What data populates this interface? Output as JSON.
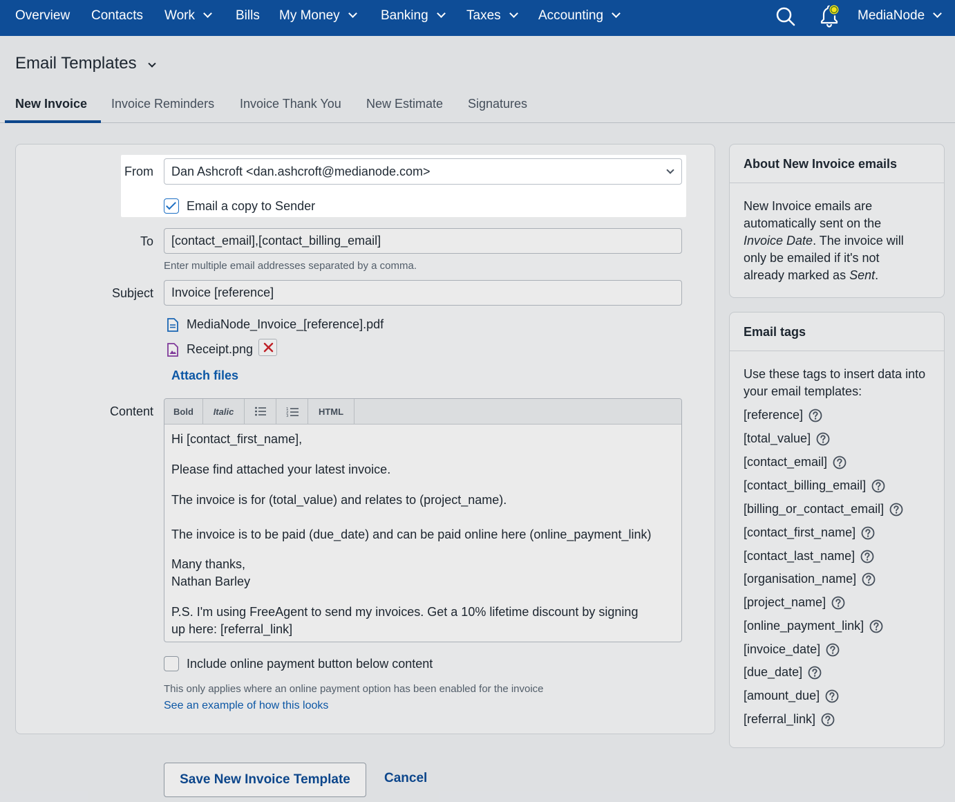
{
  "nav": {
    "items": [
      {
        "label": "Overview",
        "dropdown": false
      },
      {
        "label": "Contacts",
        "dropdown": false
      },
      {
        "label": "Work",
        "dropdown": true
      },
      {
        "label": "Bills",
        "dropdown": false
      },
      {
        "label": "My Money",
        "dropdown": true
      },
      {
        "label": "Banking",
        "dropdown": true
      },
      {
        "label": "Taxes",
        "dropdown": true
      },
      {
        "label": "Accounting",
        "dropdown": true
      }
    ],
    "account": "MediaNode",
    "icons": [
      "search-icon",
      "bell-icon"
    ],
    "brand_color": "#0e4d97"
  },
  "page": {
    "title": "Email Templates",
    "tabs": [
      {
        "label": "New Invoice",
        "active": true
      },
      {
        "label": "Invoice Reminders",
        "active": false
      },
      {
        "label": "Invoice Thank You",
        "active": false
      },
      {
        "label": "New Estimate",
        "active": false
      },
      {
        "label": "Signatures",
        "active": false
      }
    ]
  },
  "form": {
    "from_label": "From",
    "from_value": "Dan Ashcroft <dan.ashcroft@medianode.com>",
    "copy_sender_label": "Email a copy to Sender",
    "copy_sender_checked": true,
    "to_label": "To",
    "to_value": "[contact_email],[contact_billing_email]",
    "to_hint": "Enter multiple email addresses separated by a comma.",
    "subject_label": "Subject",
    "subject_value": "Invoice [reference]",
    "attachments": [
      {
        "name": "MediaNode_Invoice_[reference].pdf",
        "icon": "document-icon",
        "removable": false
      },
      {
        "name": "Receipt.png",
        "icon": "image-file-icon",
        "removable": true
      }
    ],
    "attach_files_label": "Attach files",
    "content_label": "Content",
    "toolbar": {
      "bold": "Bold",
      "italic": "Italic",
      "bullet_list_icon": "bullet-list-icon",
      "numbered_list_icon": "numbered-list-icon",
      "html": "HTML"
    },
    "content_lines": [
      "Hi [contact_first_name],",
      "Please find attached your latest invoice.",
      "The invoice is for (total_value) and relates to (project_name).",
      "The invoice is to be paid (due_date) and can be paid online here (online_payment_link)",
      "Many thanks,",
      "Nathan Barley",
      "P.S. I'm using FreeAgent to send my invoices. Get a 10% lifetime discount by signing",
      "up here: [referral_link]"
    ],
    "payment_button_label": "Include online payment button below content",
    "payment_button_checked": false,
    "payment_hint": "This only applies where an online payment option has been enabled for the invoice",
    "example_link": "See an example of how this looks"
  },
  "actions": {
    "save": "Save New Invoice Template",
    "cancel": "Cancel"
  },
  "about": {
    "heading": "About New Invoice emails",
    "text_1": "New Invoice emails are",
    "text_2": "automatically sent on the",
    "text_3_italic": "Invoice Date",
    "text_3_rest": ". The invoice will",
    "text_4": "only be emailed if it's not",
    "text_5": "already marked as ",
    "text_5_italic": "Sent",
    "text_5_end": "."
  },
  "tags": {
    "heading": "Email tags",
    "intro_1": "Use these tags to insert data into",
    "intro_2": "your email templates:",
    "list": [
      "[reference]",
      "[total_value]",
      "[contact_email]",
      "[contact_billing_email]",
      "[billing_or_contact_email]",
      "[contact_first_name]",
      "[contact_last_name]",
      "[organisation_name]",
      "[project_name]",
      "[online_payment_link]",
      "[invoice_date]",
      "[due_date]",
      "[amount_due]",
      "[referral_link]"
    ]
  }
}
